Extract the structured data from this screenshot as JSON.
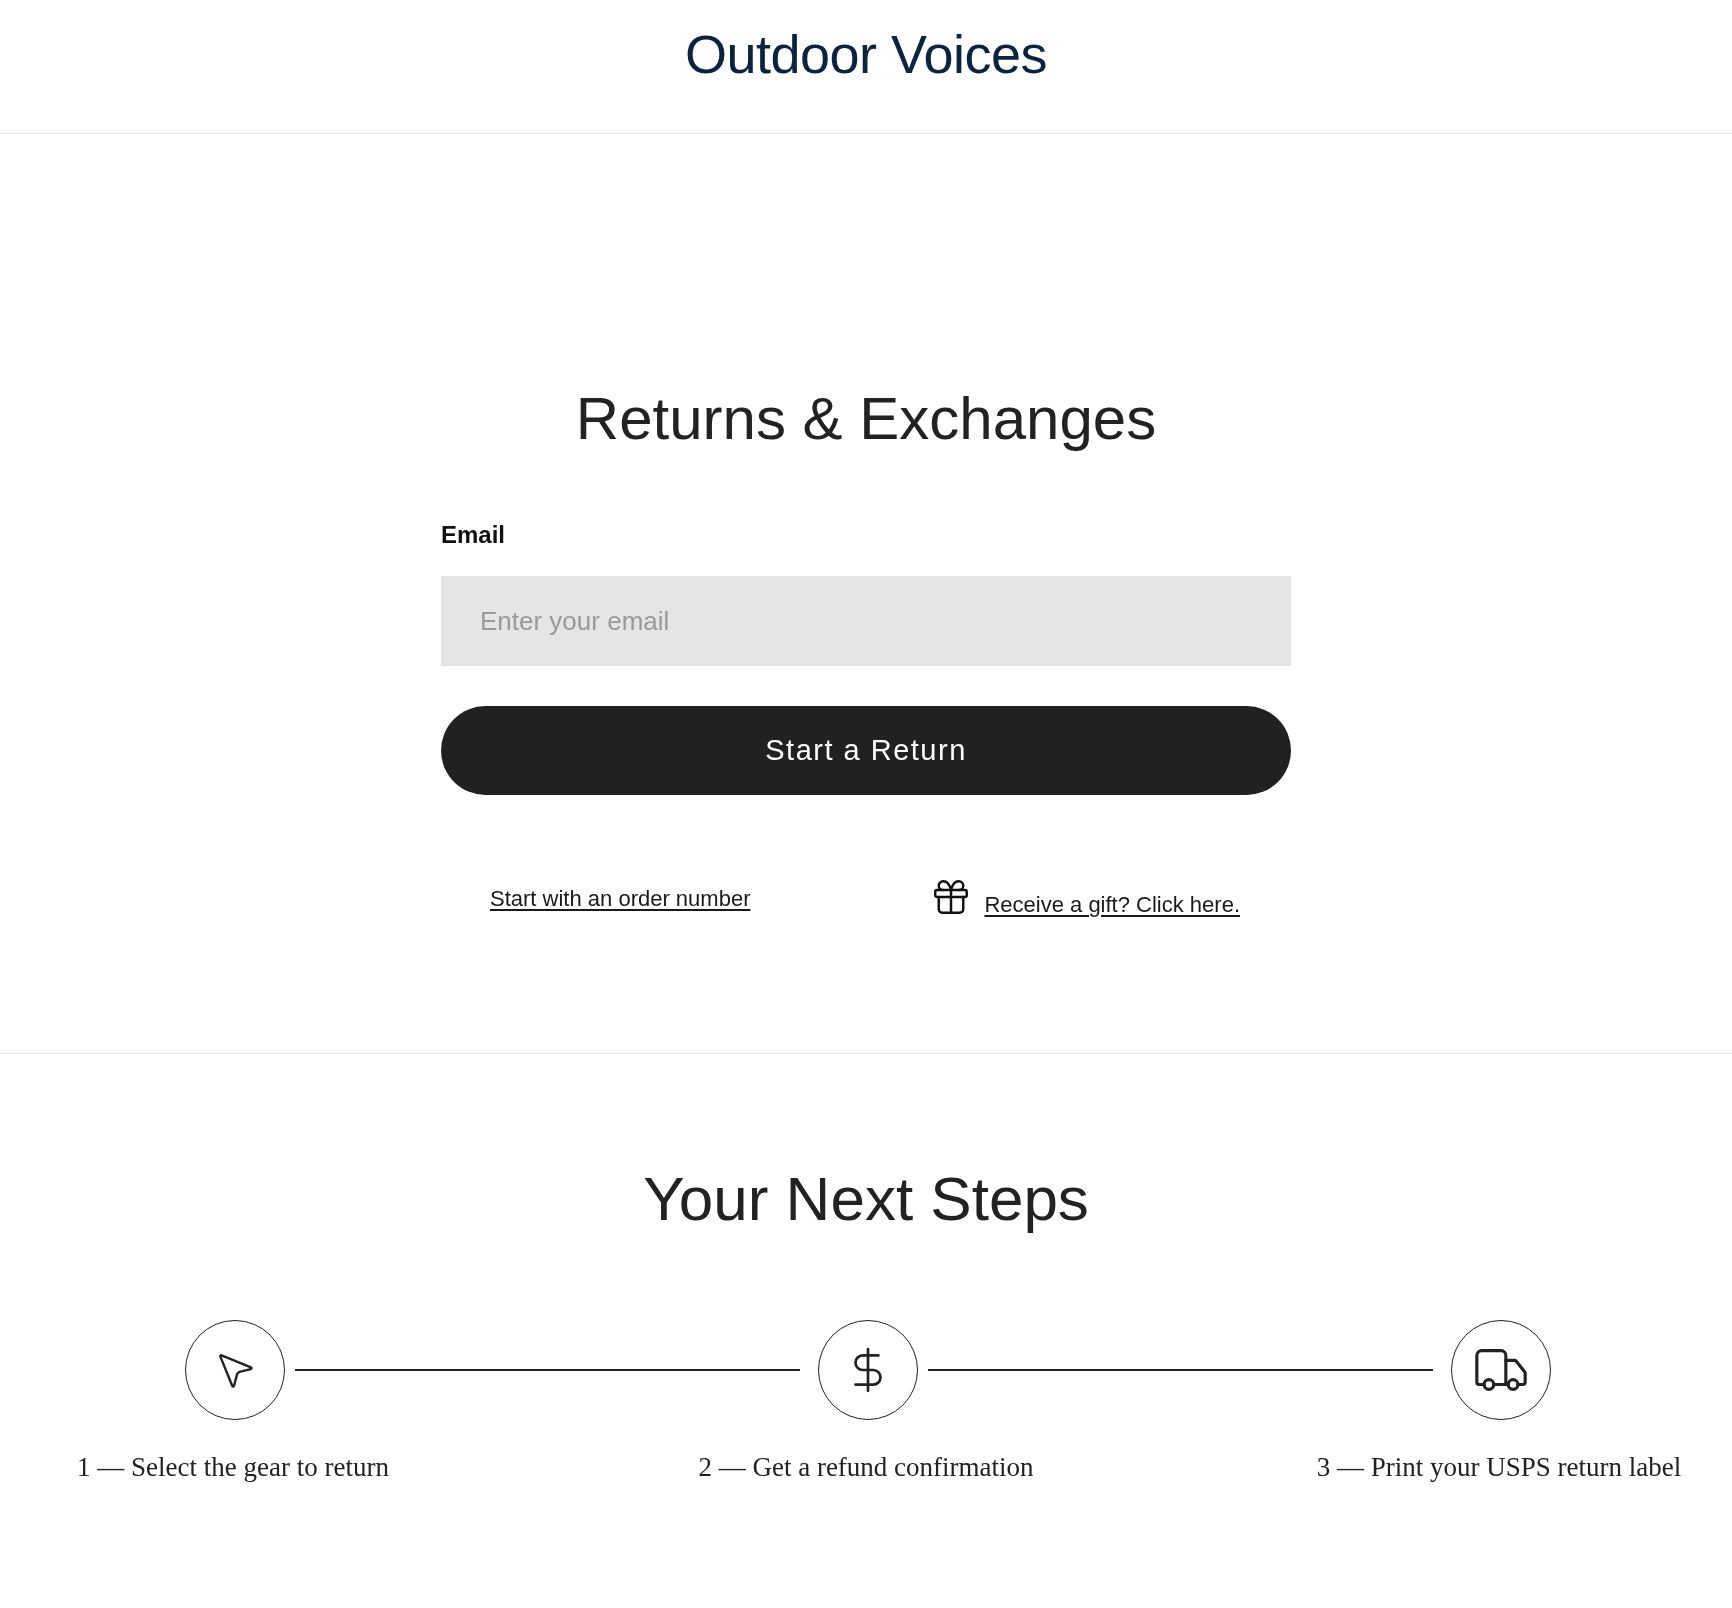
{
  "header": {
    "logo": "Outdoor Voices"
  },
  "returns": {
    "title": "Returns & Exchanges",
    "email": {
      "label": "Email",
      "placeholder": "Enter your email"
    },
    "submit": "Start a Return",
    "links": {
      "order_number": "Start with an order number",
      "gift": "Receive a gift? Click here."
    }
  },
  "next_steps": {
    "title": "Your Next Steps",
    "steps": [
      {
        "label": "1 — Select the gear to return"
      },
      {
        "label": "2 — Get a refund confirmation"
      },
      {
        "label": "3 — Print your USPS return label"
      }
    ]
  }
}
